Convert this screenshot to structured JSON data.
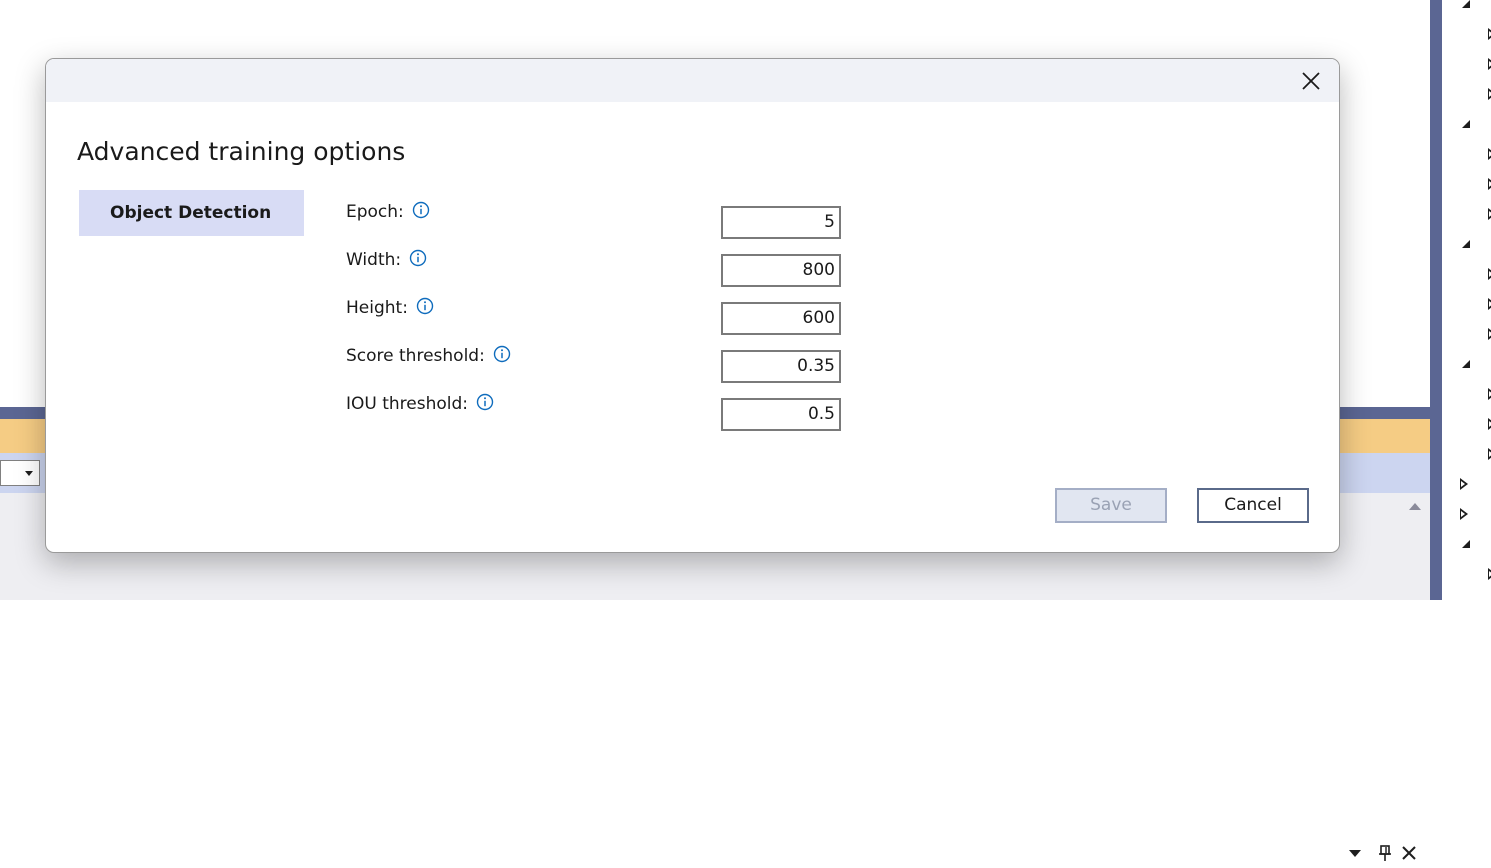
{
  "dialog": {
    "title": "Advanced training options",
    "nav_items": [
      "Object Detection"
    ],
    "options": [
      {
        "label": "Epoch:",
        "value": "5"
      },
      {
        "label": "Width:",
        "value": "800"
      },
      {
        "label": "Height:",
        "value": "600"
      },
      {
        "label": "Score threshold:",
        "value": "0.35"
      },
      {
        "label": "IOU threshold:",
        "value": "0.5"
      }
    ],
    "buttons": {
      "save": "Save",
      "cancel": "Cancel"
    }
  },
  "icons": [
    "close-icon",
    "info-icon",
    "pin-icon",
    "dropdown-arrow-icon",
    "tree-expanded-icon",
    "tree-collapsed-icon"
  ],
  "colors": {
    "accent": "#0f6cbd",
    "nav_selected": "#d8dcf5",
    "ide_band": "#5b6693",
    "toolwindow_header": "#f5cc84"
  }
}
